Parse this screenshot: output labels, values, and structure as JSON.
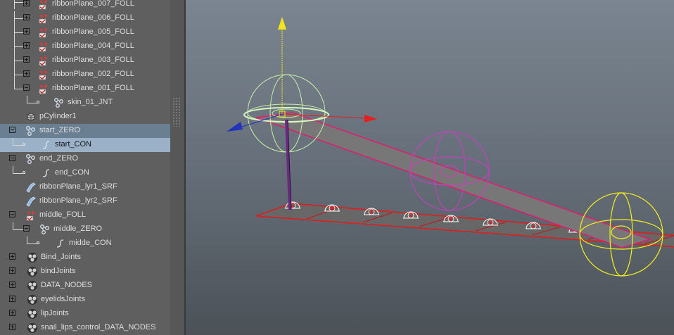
{
  "outliner": {
    "items": [
      {
        "label": "ribbonPlane_007_FOLL",
        "kind": "follicle",
        "expander": "plus"
      },
      {
        "label": "ribbonPlane_006_FOLL",
        "kind": "follicle",
        "expander": "plus"
      },
      {
        "label": "ribbonPlane_005_FOLL",
        "kind": "follicle",
        "expander": "plus"
      },
      {
        "label": "ribbonPlane_004_FOLL",
        "kind": "follicle",
        "expander": "plus"
      },
      {
        "label": "ribbonPlane_003_FOLL",
        "kind": "follicle",
        "expander": "plus"
      },
      {
        "label": "ribbonPlane_002_FOLL",
        "kind": "follicle",
        "expander": "plus"
      },
      {
        "label": "ribbonPlane_001_FOLL",
        "kind": "follicle",
        "expander": "minus"
      },
      {
        "label": "skin_01_JNT",
        "kind": "joint",
        "expander": "none"
      },
      {
        "label": "pCylinder1",
        "kind": "mesh",
        "expander": "none"
      },
      {
        "label": "start_ZERO",
        "kind": "group",
        "expander": "minus",
        "state": "highlighted"
      },
      {
        "label": "start_CON",
        "kind": "curve",
        "expander": "none",
        "state": "selected"
      },
      {
        "label": "end_ZERO",
        "kind": "group",
        "expander": "minus"
      },
      {
        "label": "end_CON",
        "kind": "curve",
        "expander": "none"
      },
      {
        "label": "ribbonPlane_lyr1_SRF",
        "kind": "surface",
        "expander": "none"
      },
      {
        "label": "ribbonPlane_lyr2_SRF",
        "kind": "surface",
        "expander": "none"
      },
      {
        "label": "middle_FOLL",
        "kind": "follicle",
        "expander": "minus"
      },
      {
        "label": "middle_ZERO",
        "kind": "group",
        "expander": "minus"
      },
      {
        "label": "midde_CON",
        "kind": "curve",
        "expander": "none"
      },
      {
        "label": "Bind_Joints",
        "kind": "set",
        "expander": "plus"
      },
      {
        "label": "bindJoints",
        "kind": "set",
        "expander": "plus"
      },
      {
        "label": "DATA_NODES",
        "kind": "set",
        "expander": "plus"
      },
      {
        "label": "eyelidsJoints",
        "kind": "set",
        "expander": "plus"
      },
      {
        "label": "lipJoints",
        "kind": "set",
        "expander": "plus"
      },
      {
        "label": "snail_lips_control_DATA_NODES",
        "kind": "set",
        "expander": "plus"
      }
    ]
  },
  "viewport": {
    "manipulator": {
      "y_axis": "#f2e61b",
      "x_axis": "#e81e1e",
      "z_axis": "#2233bb"
    },
    "colors": {
      "start_con": "#c8f0a8",
      "end_con": "#f2ef1e",
      "middle_con": "#d23ac8",
      "ribbon_edge": "#e01c6e",
      "base_plane": "#e81818",
      "follicle": "#ffffff"
    }
  }
}
